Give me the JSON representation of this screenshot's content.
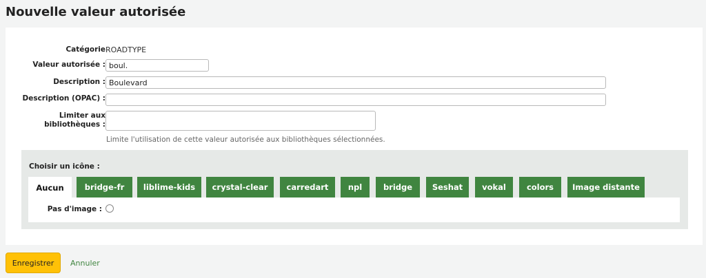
{
  "page": {
    "title": "Nouvelle valeur autorisée"
  },
  "form": {
    "category_label": "Catégorie",
    "category_value": "ROADTYPE",
    "value_label": "Valeur autorisée :",
    "value_value": "boul.",
    "description_label": "Description :",
    "description_value": "Boulevard",
    "description_opac_label": "Description (OPAC) :",
    "description_opac_value": "",
    "libraries_label_line1": "Limiter aux",
    "libraries_label_line2": "bibliothèques :",
    "libraries_hint": "Limite l'utilisation de cette valeur autorisée aux bibliothèques sélectionnées."
  },
  "icons": {
    "title": "Choisir un icône :",
    "tabs": [
      {
        "label": "Aucun",
        "active": true
      },
      {
        "label": "bridge-fr"
      },
      {
        "label": "liblime-kids"
      },
      {
        "label": "crystal-clear"
      },
      {
        "label": "carredart"
      },
      {
        "label": "npl"
      },
      {
        "label": "bridge"
      },
      {
        "label": "Seshat"
      },
      {
        "label": "vokal"
      },
      {
        "label": "colors"
      },
      {
        "label": "Image distante"
      }
    ],
    "no_image_label": "Pas d'image :"
  },
  "actions": {
    "save_label": "Enregistrer",
    "cancel_label": "Annuler"
  },
  "colors": {
    "accent": "#408540",
    "save": "#ffc107",
    "background": "#f3f4f4"
  }
}
